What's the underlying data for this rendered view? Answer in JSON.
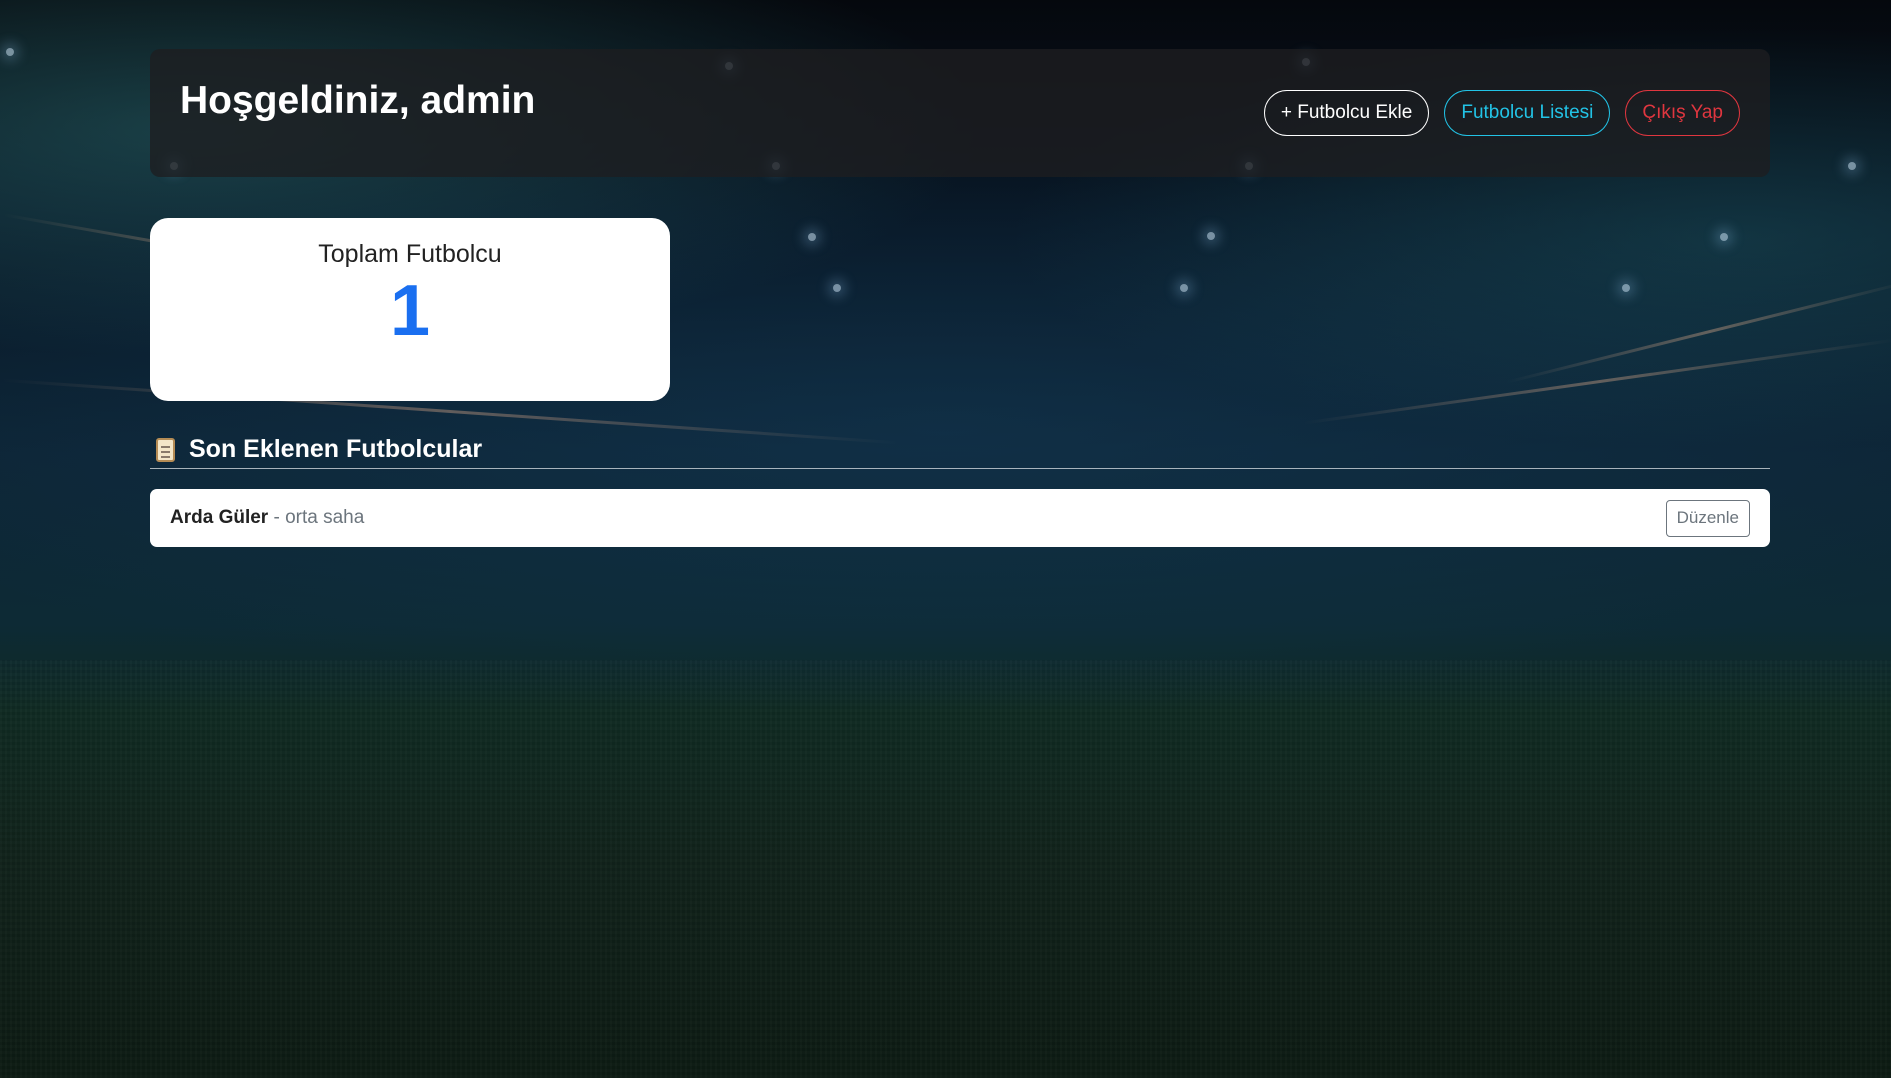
{
  "header": {
    "title": "Hoşgeldiniz, admin",
    "buttons": {
      "add_player": "+ Futbolcu Ekle",
      "player_list": "Futbolcu Listesi",
      "logout": "Çıkış Yap"
    }
  },
  "stats": {
    "total_players_label": "Toplam Futbolcu",
    "total_players_value": "1"
  },
  "recent": {
    "title": "Son Eklenen Futbolcular",
    "icon": "clipboard-icon",
    "players": [
      {
        "name": "Arda Güler",
        "separator": " - ",
        "position": "orta saha",
        "edit_label": "Düzenle"
      }
    ]
  },
  "colors": {
    "accent_blue": "#1a6ff0",
    "info_cyan": "#22c3e6",
    "danger_red": "#e0363f"
  }
}
